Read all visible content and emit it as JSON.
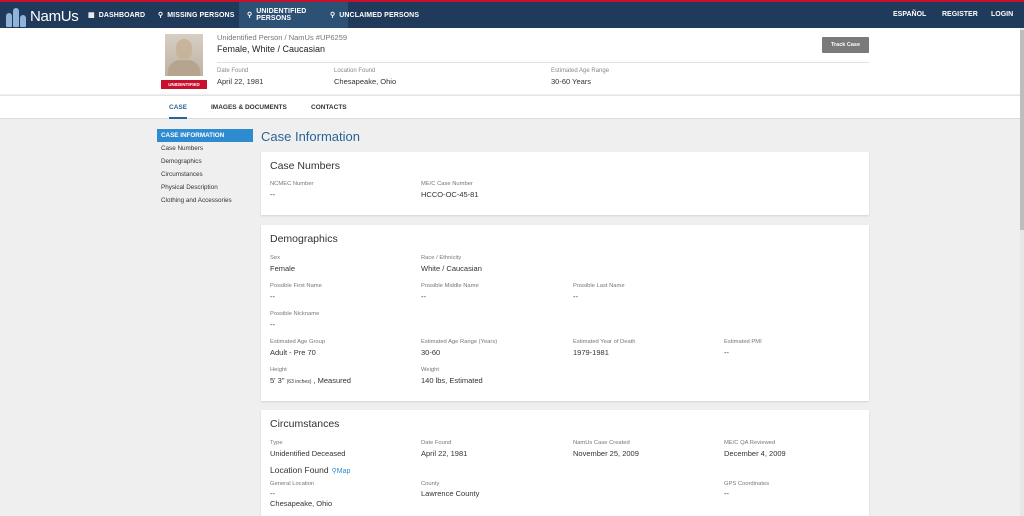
{
  "nav": {
    "logo": "NamUs",
    "items": [
      {
        "label": "DASHBOARD",
        "icon": "grid-icon"
      },
      {
        "label": "MISSING PERSONS",
        "icon": "search-icon"
      },
      {
        "label": "UNIDENTIFIED PERSONS",
        "icon": "search-icon"
      },
      {
        "label": "UNCLAIMED PERSONS",
        "icon": "search-icon"
      }
    ],
    "right": [
      "ESPAÑOL",
      "REGISTER",
      "LOGIN"
    ]
  },
  "header": {
    "case_id": "Unidentified Person / NamUs #UP6259",
    "title": "Female, White / Caucasian",
    "badge": "UNIDENTIFIED",
    "track_button": "Track Case",
    "date_found_label": "Date Found",
    "date_found": "April 22, 1981",
    "location_found_label": "Location Found",
    "location_found": "Chesapeake, Ohio",
    "age_range_label": "Estimated Age Range",
    "age_range": "30-60 Years"
  },
  "tabs": [
    "CASE",
    "IMAGES & DOCUMENTS",
    "CONTACTS"
  ],
  "sidebar": {
    "heading": "CASE INFORMATION",
    "items": [
      "Case Numbers",
      "Demographics",
      "Circumstances",
      "Physical Description",
      "Clothing and Accessories"
    ]
  },
  "main": {
    "title": "Case Information",
    "case_numbers": {
      "title": "Case Numbers",
      "ncmec_label": "NCMEC Number",
      "ncmec_value": "--",
      "mec_label": "ME/C Case Number",
      "mec_value": "HCCO-OC-45-81"
    },
    "demographics": {
      "title": "Demographics",
      "sex_label": "Sex",
      "sex": "Female",
      "race_label": "Race / Ethnicity",
      "race": "White / Caucasian",
      "first_label": "Possible First Name",
      "first": "--",
      "middle_label": "Possible Middle Name",
      "middle": "--",
      "last_label": "Possible Last Name",
      "last": "--",
      "nick_label": "Possible Nickname",
      "nick": "--",
      "age_group_label": "Estimated Age Group",
      "age_group": "Adult - Pre 70",
      "age_range_label": "Estimated Age Range (Years)",
      "age_range": "30-60",
      "yod_label": "Estimated Year of Death",
      "yod": "1979-1981",
      "pmi_label": "Estimated PMI",
      "pmi": "--",
      "height_label": "Height",
      "height_main": "5' 3\"",
      "height_inches": "(63 inches)",
      "height_suffix": ", Measured",
      "weight_label": "Weight",
      "weight": "140 lbs, Estimated"
    },
    "circumstances": {
      "title": "Circumstances",
      "type_label": "Type",
      "type": "Unidentified Deceased",
      "date_found_label": "Date Found",
      "date_found": "April 22, 1981",
      "created_label": "NamUs Case Created",
      "created": "November 25, 2009",
      "qa_label": "ME/C QA Reviewed",
      "qa": "December 4, 2009",
      "location_heading": "Location Found",
      "map_link": "Map",
      "general_label": "General Location",
      "general_1": "--",
      "general_2": "Chesapeake, Ohio",
      "county_label": "County",
      "county": "Lawrence County",
      "gps_label": "GPS Coordinates",
      "gps": "--"
    }
  },
  "colors": {
    "nav_bg": "#1f3a5a",
    "accent_red": "#c8102e",
    "link_blue": "#2a6496",
    "sidebar_active": "#2e8bd0"
  }
}
